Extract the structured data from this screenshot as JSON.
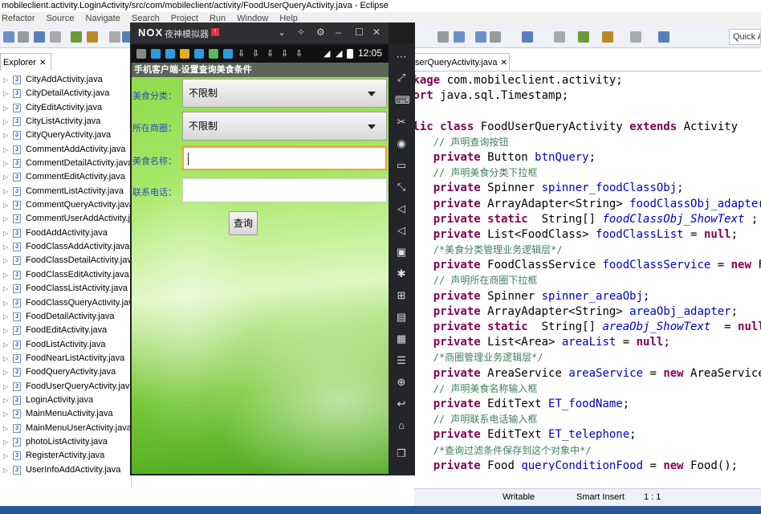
{
  "window": {
    "title": "mobileclient.activity.LoginActivity/src/com/mobileclient/activity/FoodUserQueryActivity.java - Eclipse"
  },
  "menu": [
    "Refactor",
    "Source",
    "Navigate",
    "Search",
    "Project",
    "Run",
    "Window",
    "Help"
  ],
  "toolbar": {
    "quick_access": "Quick A"
  },
  "explorer": {
    "tab_label": "Explorer",
    "files": [
      "CityAddActivity.java",
      "CityDetailActivity.java",
      "CityEditActivity.java",
      "CityListActivity.java",
      "CityQueryActivity.java",
      "CommentAddActivity.java",
      "CommentDetailActivity.java",
      "CommentEditActivity.java",
      "CommentListActivity.java",
      "CommentQueryActivity.java",
      "CommentUserAddActivity.java",
      "FoodAddActivity.java",
      "FoodClassAddActivity.java",
      "FoodClassDetailActivity.java",
      "FoodClassEditActivity.java",
      "FoodClassListActivity.java",
      "FoodClassQueryActivity.java",
      "FoodDetailActivity.java",
      "FoodEditActivity.java",
      "FoodListActivity.java",
      "FoodNearListActivity.java",
      "FoodQueryActivity.java",
      "FoodUserQueryActivity.java",
      "LoginActivity.java",
      "MainMenuActivity.java",
      "MainMenuUserActivity.java",
      "photoListActivity.java",
      "RegisterActivity.java",
      "UserInfoAddActivity.java"
    ]
  },
  "editor": {
    "tab_label": "serQueryActivity.java",
    "code": [
      [
        [
          "kw",
          "ckage "
        ],
        [
          "pl",
          "com.mobileclient.activity;"
        ]
      ],
      [
        [
          "kw",
          "port "
        ],
        [
          "pl",
          "java.sql.Timestamp;"
        ]
      ],
      [
        [
          "pl",
          ""
        ]
      ],
      [
        [
          "kw",
          "blic class "
        ],
        [
          "pl",
          "FoodUserQueryActivity "
        ],
        [
          "kw",
          "extends "
        ],
        [
          "pl",
          "Activity"
        ]
      ],
      [
        [
          "pl",
          "    "
        ],
        [
          "cm",
          "// 声明查询按钮"
        ]
      ],
      [
        [
          "pl",
          "    "
        ],
        [
          "kw",
          "private "
        ],
        [
          "pl",
          "Button "
        ],
        [
          "fld",
          "btnQuery"
        ],
        [
          "pl",
          ";"
        ]
      ],
      [
        [
          "pl",
          "    "
        ],
        [
          "cm",
          "// 声明美食分类下拉框"
        ]
      ],
      [
        [
          "pl",
          "    "
        ],
        [
          "kw",
          "private "
        ],
        [
          "pl",
          "Spinner "
        ],
        [
          "fld",
          "spinner_foodClassObj"
        ],
        [
          "pl",
          ";"
        ]
      ],
      [
        [
          "pl",
          "    "
        ],
        [
          "kw",
          "private "
        ],
        [
          "pl",
          "ArrayAdapter<String> "
        ],
        [
          "fld",
          "foodClassObj_adapter"
        ],
        [
          "pl",
          ";"
        ]
      ],
      [
        [
          "pl",
          "    "
        ],
        [
          "kw",
          "private static  "
        ],
        [
          "pl",
          "String[] "
        ],
        [
          "sfld",
          "foodClassObj_ShowText"
        ],
        [
          "pl",
          " ;"
        ]
      ],
      [
        [
          "pl",
          "    "
        ],
        [
          "kw",
          "private "
        ],
        [
          "pl",
          "List<FoodClass> "
        ],
        [
          "fld",
          "foodClassList"
        ],
        [
          "pl",
          " = "
        ],
        [
          "kw",
          "null"
        ],
        [
          "pl",
          ";"
        ]
      ],
      [
        [
          "pl",
          "    "
        ],
        [
          "cm",
          "/*美食分类管理业务逻辑层*/"
        ]
      ],
      [
        [
          "pl",
          "    "
        ],
        [
          "kw",
          "private "
        ],
        [
          "pl",
          "FoodClassService "
        ],
        [
          "fld",
          "foodClassService"
        ],
        [
          "pl",
          " = "
        ],
        [
          "kw",
          "new "
        ],
        [
          "pl",
          "FoodClassService();"
        ]
      ],
      [
        [
          "pl",
          "    "
        ],
        [
          "cm",
          "// 声明所在商圈下拉框"
        ]
      ],
      [
        [
          "pl",
          "    "
        ],
        [
          "kw",
          "private "
        ],
        [
          "pl",
          "Spinner "
        ],
        [
          "fld",
          "spinner_areaObj"
        ],
        [
          "pl",
          ";"
        ]
      ],
      [
        [
          "pl",
          "    "
        ],
        [
          "kw",
          "private "
        ],
        [
          "pl",
          "ArrayAdapter<String> "
        ],
        [
          "fld",
          "areaObj_adapter"
        ],
        [
          "pl",
          ";"
        ]
      ],
      [
        [
          "pl",
          "    "
        ],
        [
          "kw",
          "private static  "
        ],
        [
          "pl",
          "String[] "
        ],
        [
          "sfld",
          "areaObj_ShowText"
        ],
        [
          "pl",
          "  = "
        ],
        [
          "kw",
          "null"
        ],
        [
          "pl",
          ";"
        ]
      ],
      [
        [
          "pl",
          "    "
        ],
        [
          "kw",
          "private "
        ],
        [
          "pl",
          "List<Area> "
        ],
        [
          "fld",
          "areaList"
        ],
        [
          "pl",
          " = "
        ],
        [
          "kw",
          "null"
        ],
        [
          "pl",
          ";"
        ]
      ],
      [
        [
          "pl",
          "    "
        ],
        [
          "cm",
          "/*商圈管理业务逻辑层*/"
        ]
      ],
      [
        [
          "pl",
          "    "
        ],
        [
          "kw",
          "private "
        ],
        [
          "pl",
          "AreaService "
        ],
        [
          "fld",
          "areaService"
        ],
        [
          "pl",
          " = "
        ],
        [
          "kw",
          "new "
        ],
        [
          "pl",
          "AreaService();"
        ]
      ],
      [
        [
          "pl",
          "    "
        ],
        [
          "cm",
          "// 声明美食名称输入框"
        ]
      ],
      [
        [
          "pl",
          "    "
        ],
        [
          "kw",
          "private "
        ],
        [
          "pl",
          "EditText "
        ],
        [
          "fld",
          "ET_foodName"
        ],
        [
          "pl",
          ";"
        ]
      ],
      [
        [
          "pl",
          "    "
        ],
        [
          "cm",
          "// 声明联系电话输入框"
        ]
      ],
      [
        [
          "pl",
          "    "
        ],
        [
          "kw",
          "private "
        ],
        [
          "pl",
          "EditText "
        ],
        [
          "fld",
          "ET_telephone"
        ],
        [
          "pl",
          ";"
        ]
      ],
      [
        [
          "pl",
          "    "
        ],
        [
          "cm",
          "/*查询过滤条件保存到这个对象中*/"
        ]
      ],
      [
        [
          "pl",
          "    "
        ],
        [
          "kw",
          "private "
        ],
        [
          "pl",
          "Food "
        ],
        [
          "fld",
          "queryConditionFood"
        ],
        [
          "pl",
          " = "
        ],
        [
          "kw",
          "new "
        ],
        [
          "pl",
          "Food();"
        ]
      ]
    ]
  },
  "status": {
    "writable": "Writable",
    "insert_mode": "Smart Insert",
    "position": "1 : 1"
  },
  "emulator": {
    "logo": "NOX",
    "title": "夜神模拟器",
    "badge": "!",
    "clock": "12:05",
    "app": {
      "title": "手机客户端-设置查询美食条件",
      "food_class_label": "美食分类：",
      "food_class_value": "不限制",
      "area_label": "所在商圈：",
      "area_value": "不限制",
      "food_name_label": "美食名称：",
      "food_name_value": "",
      "telephone_label": "联系电话：",
      "telephone_value": "",
      "query_button": "查询"
    }
  },
  "colors": {
    "keyword": "#7f0055",
    "comment": "#3f7f5f",
    "field": "#0000c0",
    "app_green": "#8cd94a",
    "label_blue": "#2450b8"
  }
}
